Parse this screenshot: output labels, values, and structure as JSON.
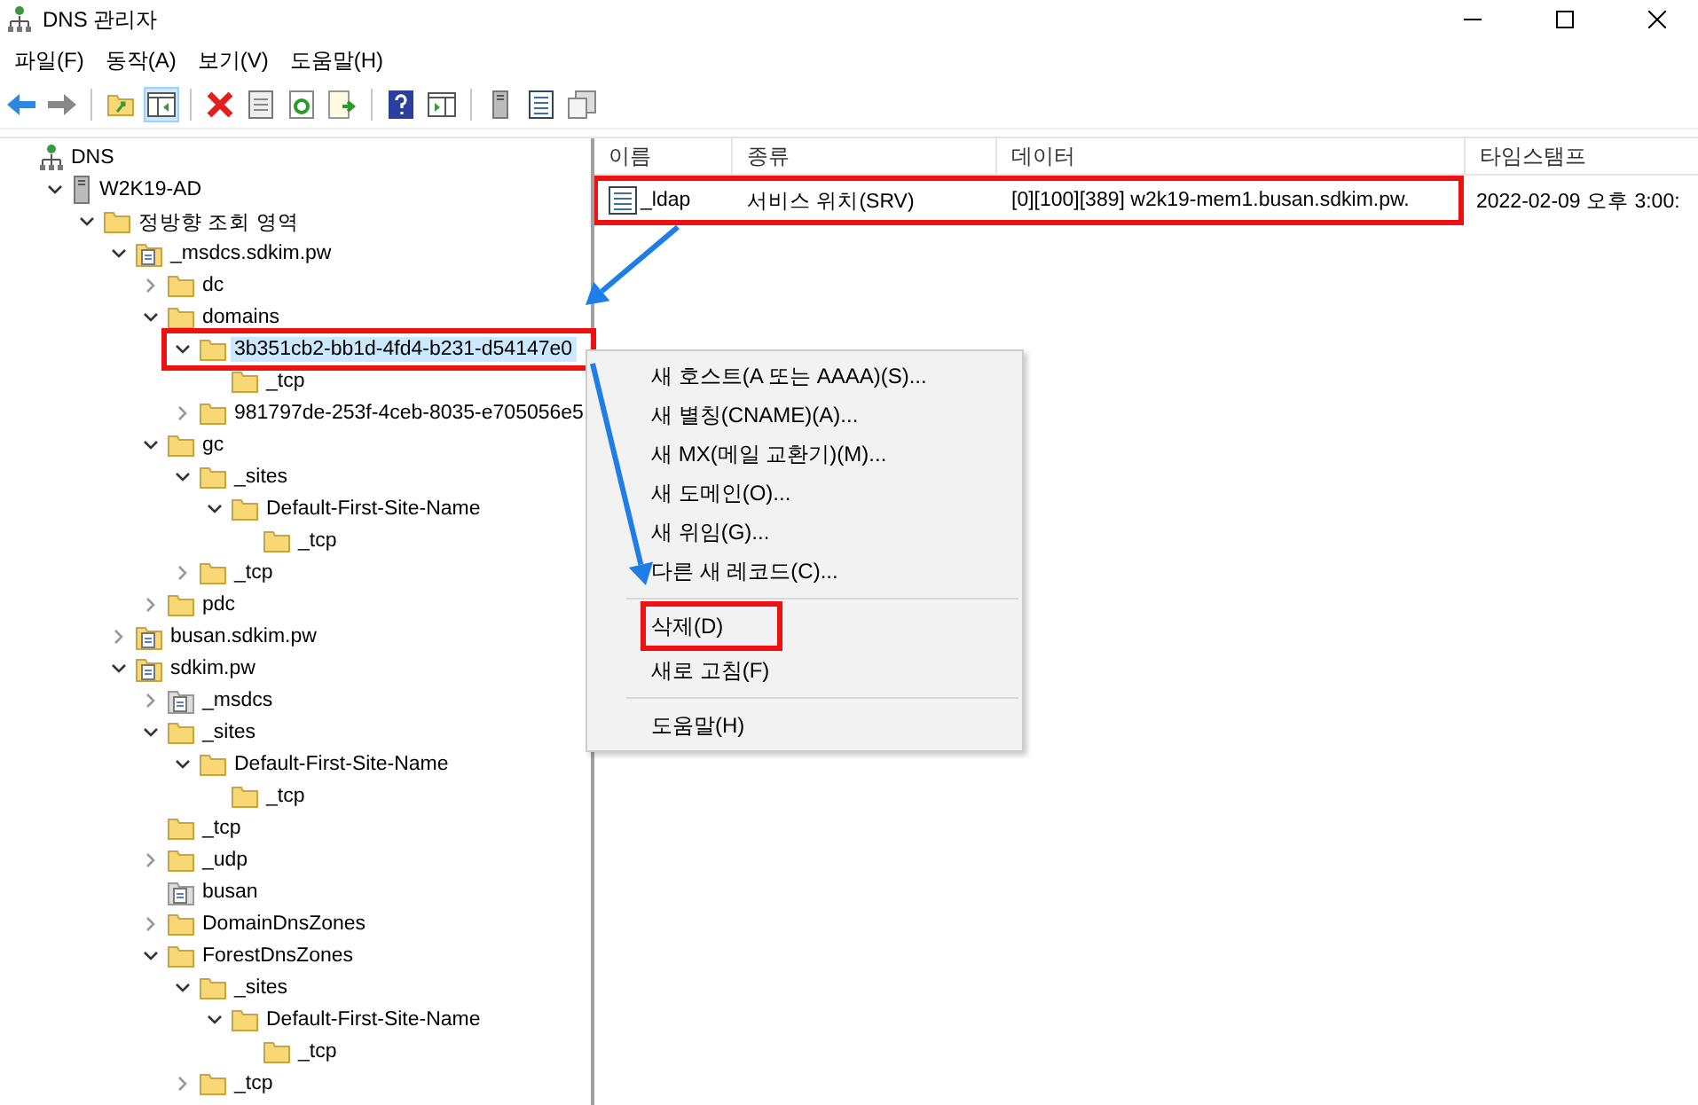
{
  "window": {
    "title": "DNS 관리자"
  },
  "menu": [
    "파일(F)",
    "동작(A)",
    "보기(V)",
    "도움말(H)"
  ],
  "toolbar": [
    {
      "kind": "back",
      "selected": false
    },
    {
      "kind": "forward",
      "selected": false
    },
    {
      "kind": "sep"
    },
    {
      "kind": "up",
      "selected": false
    },
    {
      "kind": "panel",
      "selected": true
    },
    {
      "kind": "sep"
    },
    {
      "kind": "delete",
      "selected": false
    },
    {
      "kind": "props",
      "selected": false
    },
    {
      "kind": "refresh",
      "selected": false
    },
    {
      "kind": "export",
      "selected": false
    },
    {
      "kind": "sep"
    },
    {
      "kind": "help",
      "selected": false
    },
    {
      "kind": "action",
      "selected": false
    },
    {
      "kind": "sep"
    },
    {
      "kind": "server",
      "selected": false
    },
    {
      "kind": "list",
      "selected": false
    },
    {
      "kind": "copy",
      "selected": false
    }
  ],
  "tree": [
    {
      "label": "DNS",
      "kind": "dns",
      "selected": false,
      "children": [
        {
          "label": "W2K19-AD",
          "kind": "server",
          "expanded": true,
          "selected": false,
          "children": [
            {
              "label": "정방향 조회 영역",
              "kind": "folder",
              "expanded": true,
              "selected": false,
              "children": [
                {
                  "label": "_msdcs.sdkim.pw",
                  "kind": "zone",
                  "expanded": true,
                  "selected": false,
                  "children": [
                    {
                      "label": "dc",
                      "kind": "folder",
                      "expanded": false,
                      "selected": false
                    },
                    {
                      "label": "domains",
                      "kind": "folder",
                      "expanded": true,
                      "selected": false,
                      "children": [
                        {
                          "label": "3b351cb2-bb1d-4fd4-b231-d54147e0",
                          "kind": "folder",
                          "expanded": true,
                          "selected": true,
                          "highlighted": true,
                          "children": [
                            {
                              "label": "_tcp",
                              "kind": "folder",
                              "selected": false
                            }
                          ]
                        },
                        {
                          "label": "981797de-253f-4ceb-8035-e705056e5",
                          "kind": "folder",
                          "expanded": false,
                          "selected": false
                        }
                      ]
                    },
                    {
                      "label": "gc",
                      "kind": "folder",
                      "expanded": true,
                      "selected": false,
                      "children": [
                        {
                          "label": "_sites",
                          "kind": "folder",
                          "expanded": true,
                          "selected": false,
                          "children": [
                            {
                              "label": "Default-First-Site-Name",
                              "kind": "folder",
                              "expanded": true,
                              "selected": false,
                              "children": [
                                {
                                  "label": "_tcp",
                                  "kind": "folder",
                                  "selected": false
                                }
                              ]
                            }
                          ]
                        },
                        {
                          "label": "_tcp",
                          "kind": "folder",
                          "expanded": false,
                          "selected": false
                        }
                      ]
                    },
                    {
                      "label": "pdc",
                      "kind": "folder",
                      "expanded": false,
                      "selected": false
                    }
                  ]
                },
                {
                  "label": "busan.sdkim.pw",
                  "kind": "zone",
                  "expanded": false,
                  "selected": false
                },
                {
                  "label": "sdkim.pw",
                  "kind": "zone",
                  "expanded": true,
                  "selected": false,
                  "children": [
                    {
                      "label": "_msdcs",
                      "kind": "delegation",
                      "expanded": false,
                      "selected": false
                    },
                    {
                      "label": "_sites",
                      "kind": "folder",
                      "expanded": true,
                      "selected": false,
                      "children": [
                        {
                          "label": "Default-First-Site-Name",
                          "kind": "folder",
                          "expanded": true,
                          "selected": false,
                          "children": [
                            {
                              "label": "_tcp",
                              "kind": "folder",
                              "selected": false
                            }
                          ]
                        }
                      ]
                    },
                    {
                      "label": "_tcp",
                      "kind": "folder",
                      "selected": false
                    },
                    {
                      "label": "_udp",
                      "kind": "folder",
                      "expanded": false,
                      "selected": false
                    },
                    {
                      "label": "busan",
                      "kind": "delegation",
                      "selected": false
                    },
                    {
                      "label": "DomainDnsZones",
                      "kind": "folder",
                      "expanded": false,
                      "selected": false
                    },
                    {
                      "label": "ForestDnsZones",
                      "kind": "folder",
                      "expanded": true,
                      "selected": false,
                      "children": [
                        {
                          "label": "_sites",
                          "kind": "folder",
                          "expanded": true,
                          "selected": false,
                          "children": [
                            {
                              "label": "Default-First-Site-Name",
                              "kind": "folder",
                              "expanded": true,
                              "selected": false,
                              "children": [
                                {
                                  "label": "_tcp",
                                  "kind": "folder",
                                  "selected": false
                                }
                              ]
                            }
                          ]
                        },
                        {
                          "label": "_tcp",
                          "kind": "folder",
                          "expanded": false,
                          "selected": false
                        }
                      ]
                    }
                  ]
                }
              ]
            }
          ]
        }
      ]
    }
  ],
  "table": {
    "columns": [
      "이름",
      "종류",
      "데이터",
      "타임스탬프"
    ],
    "rows": [
      {
        "cells": [
          "_ldap",
          "서비스 위치(SRV)",
          "[0][100][389] w2k19-mem1.busan.sdkim.pw.",
          "2022-02-09 오후 3:00:"
        ],
        "highlighted": true
      }
    ]
  },
  "context_menu": {
    "groups": [
      [
        {
          "label": "새 호스트(A 또는 AAAA)(S)...",
          "highlighted": false
        },
        {
          "label": "새 별칭(CNAME)(A)...",
          "highlighted": false
        },
        {
          "label": "새 MX(메일 교환기)(M)...",
          "highlighted": false
        },
        {
          "label": "새 도메인(O)...",
          "highlighted": false
        },
        {
          "label": "새 위임(G)...",
          "highlighted": false
        },
        {
          "label": "다른 새 레코드(C)...",
          "highlighted": false
        }
      ],
      [
        {
          "label": "삭제(D)",
          "highlighted": true
        },
        {
          "label": "새로 고침(F)",
          "highlighted": false
        }
      ],
      [
        {
          "label": "도움말(H)",
          "highlighted": false
        }
      ]
    ]
  },
  "arrows_shown": true
}
